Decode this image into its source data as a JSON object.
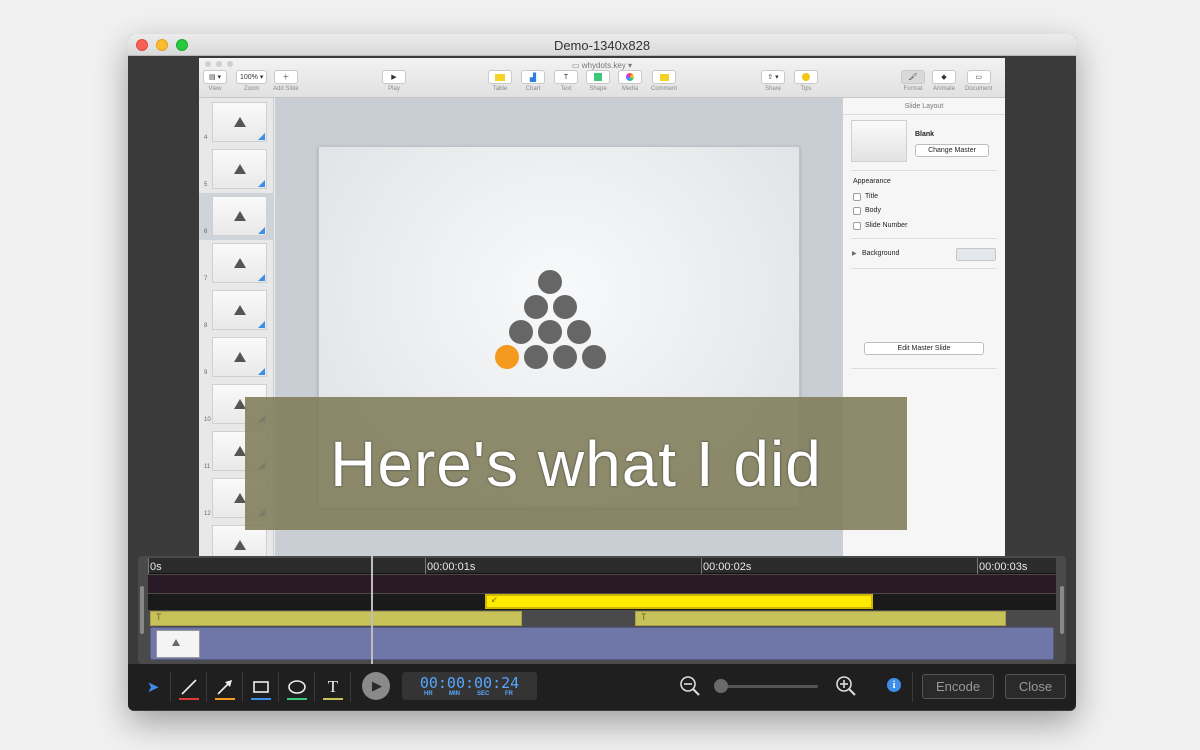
{
  "window": {
    "title": "Demo-1340x828"
  },
  "keynote": {
    "doc_title": "whydots.key",
    "toolbar": {
      "view": "View",
      "zoom": "Zoom",
      "zoom_value": "100%",
      "add_slide": "Add Slide",
      "play": "Play",
      "table": "Table",
      "chart": "Chart",
      "text": "Text",
      "shape": "Shape",
      "media": "Media",
      "comment": "Comment",
      "share": "Share",
      "tips": "Tips",
      "format": "Format",
      "animate": "Animate",
      "document": "Document"
    },
    "slide_numbers": [
      "4",
      "5",
      "6",
      "7",
      "8",
      "9",
      "10",
      "11",
      "12"
    ],
    "selected_slide": "6",
    "inspector": {
      "header": "Slide Layout",
      "master_name": "Blank",
      "change_master": "Change Master",
      "appearance": "Appearance",
      "opt_title": "Title",
      "opt_body": "Body",
      "opt_slide_number": "Slide Number",
      "background": "Background",
      "edit_master": "Edit Master Slide"
    }
  },
  "callout": {
    "text": "Here's what I did"
  },
  "timeline": {
    "ticks": [
      "0s",
      "00:00:01s",
      "00:00:02s",
      "00:00:03s"
    ]
  },
  "controls": {
    "timecode": "00:00:00:24",
    "tc_labels": [
      "HR",
      "MIN",
      "SEC",
      "FR"
    ],
    "encode": "Encode",
    "close": "Close"
  },
  "colors": {
    "accent_blue": "#3d8ee8",
    "highlight_orange": "#f59a1f",
    "callout_bg": "#7e7c58",
    "timecode_blue": "#58a6ff"
  }
}
